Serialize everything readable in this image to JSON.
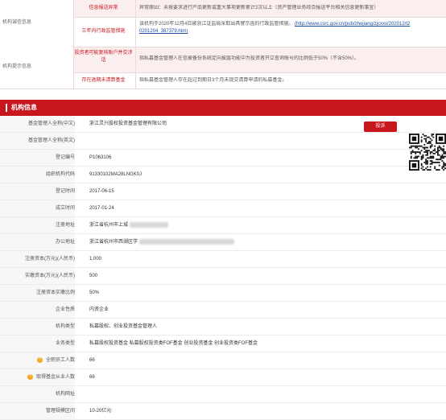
{
  "top": {
    "group1_label": "机构诚信信息",
    "group2_label": "机构提示信息",
    "rows": [
      {
        "label": "信息报送异常",
        "content": "异常原因：未按要求进行产品更新或重大事项更新累计2次以上（资产管理业务综合报送平台相关信息更新事宜）"
      },
      {
        "label": "三年内行政监管措施",
        "content": "该机构于2020年12月4日被浙江证监局采取出具警示函的行政监管措施。",
        "link": "(http://www.csrc.gov.cn/pub/zhejiang/zjcxxx/202012/t2",
        "link2": "0201204_387379.htm)"
      },
      {
        "label": "投资者可能复核账户并交涉话",
        "content": "指私募基金管理人在信披备份系统定向披露功能中为投资者开立查询账号的比例低于50%（不含50%）。"
      },
      {
        "label": "存在逾期未清算基金",
        "content": "指私募基金管理人存在超过到期日3个月未提交清算申请的私募基金。"
      }
    ]
  },
  "section": {
    "title": "机构信息"
  },
  "report_button": "投诉",
  "info_rows": [
    {
      "label": "基金管理人全称(中文)",
      "value": "浙江灵兴股权投资基金管理有限公司"
    },
    {
      "label": "基金管理人全称(英文)",
      "value": ""
    },
    {
      "label": "登记编号",
      "value": "P1063106"
    },
    {
      "label": "组织机构代码",
      "value": "91330102MA28LNGK0J"
    },
    {
      "label": "登记时间",
      "value": "2017-06-15"
    },
    {
      "label": "成立时间",
      "value": "2017-01-24"
    },
    {
      "label": "注册地址",
      "value": "浙江省杭州市上城"
    },
    {
      "label": "办公地址",
      "value": "浙江省杭州市西湖区学"
    },
    {
      "label": "注册资本(万元)(人民币)",
      "value": "1,000"
    },
    {
      "label": "实缴资本(万元)(人民币)",
      "value": "500"
    },
    {
      "label": "注册资本实缴比例",
      "value": "50%"
    },
    {
      "label": "企业性质",
      "value": "内资企业"
    },
    {
      "label": "机构类型",
      "value": "私募股权、创业投资基金管理人"
    },
    {
      "label": "业务类型",
      "value": "私募股权投资基金 私募股权投资类FOF基金 创业投资基金 创业投资类FOF基金"
    },
    {
      "label": "全职员工人数",
      "value": "66"
    },
    {
      "label": "取得基金从业人数",
      "value": "66"
    },
    {
      "label": "机构网址",
      "value": ""
    },
    {
      "label": "管理规模区间",
      "value": "10-20亿元"
    }
  ],
  "colors": {
    "brand_red": "#c8161d",
    "label_bg": "#f7f7f7",
    "warn_orange": "#f5a623"
  },
  "icons": {
    "help": "question-circle-icon",
    "qr": "qr-code-icon"
  }
}
